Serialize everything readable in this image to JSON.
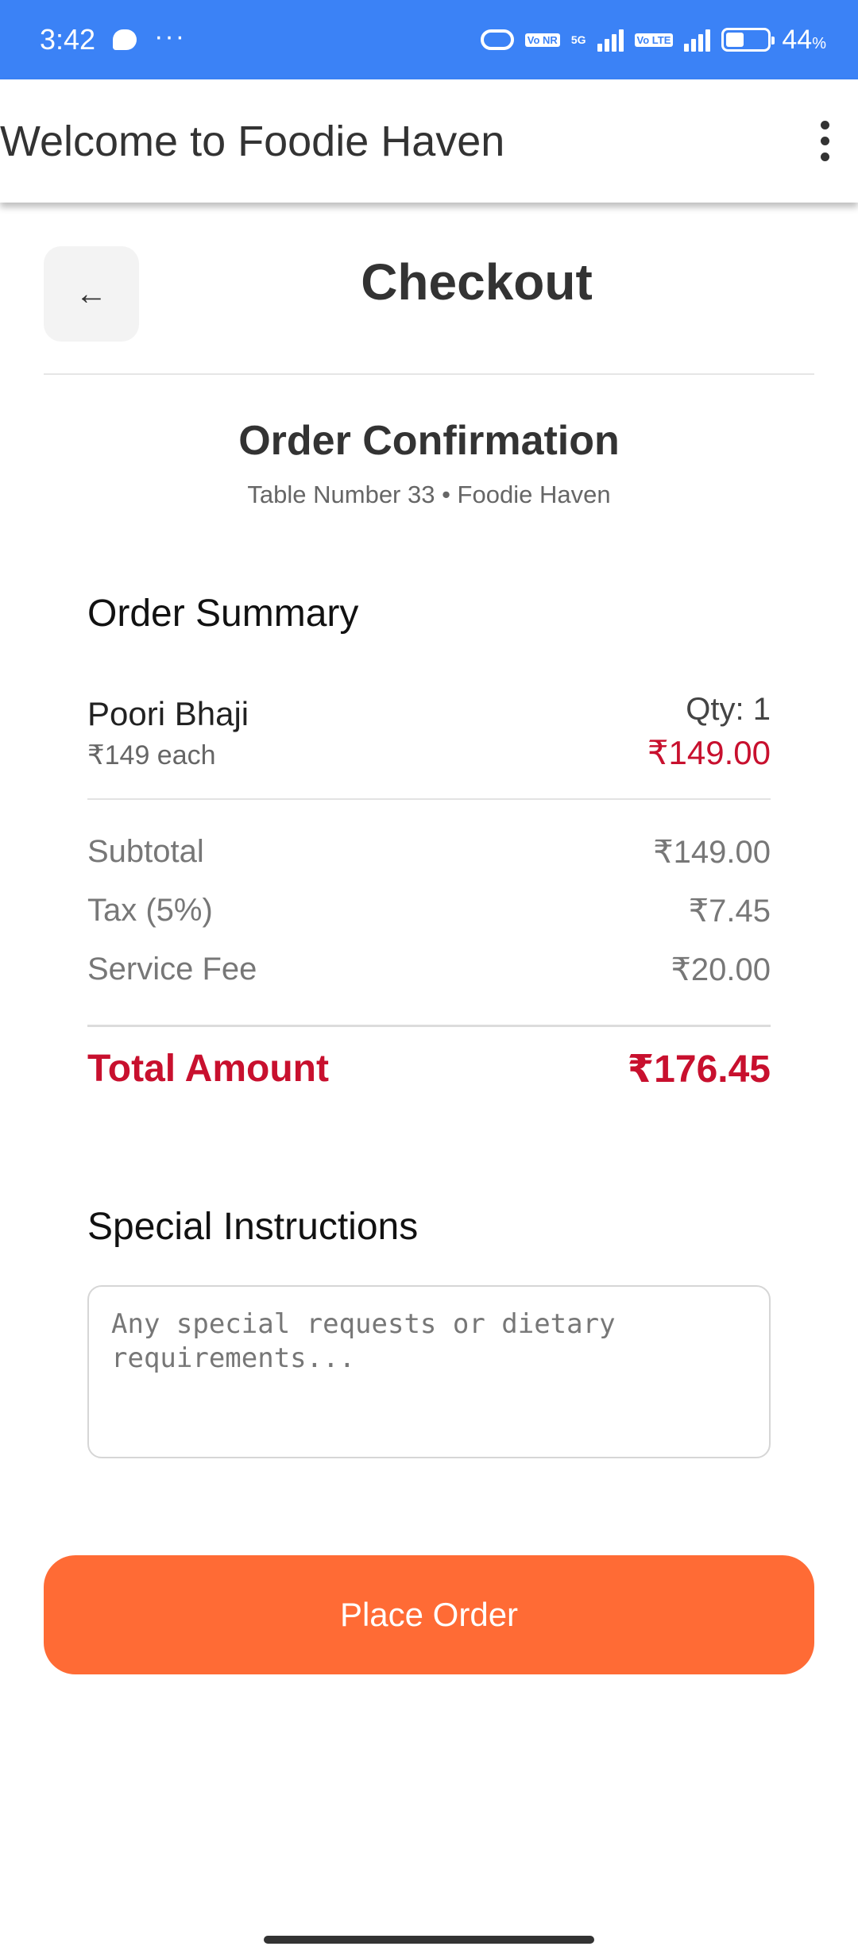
{
  "status_bar": {
    "time": "3:42",
    "network_sim1": "5G",
    "sim1_badge": "Vo NR",
    "sim2_badge": "Vo LTE",
    "battery_percent": "44",
    "battery_unit": "%",
    "battery_level": 0.44,
    "icons": [
      "chat-icon",
      "more-dots-icon",
      "link-icon",
      "signal-icon",
      "battery-icon"
    ]
  },
  "app_bar": {
    "title": "Welcome to Foodie Haven",
    "menu_icon": "kebab-menu-icon"
  },
  "checkout": {
    "back_label": "←",
    "title": "Checkout"
  },
  "confirmation": {
    "title": "Order Confirmation",
    "subtitle": "Table Number 33 • Foodie Haven"
  },
  "summary": {
    "title": "Order Summary",
    "items": [
      {
        "name": "Poori Bhaji",
        "unit_price": "₹149 each",
        "qty": "Qty: 1",
        "line_total": "₹149.00"
      }
    ],
    "fees": [
      {
        "label": "Subtotal",
        "value": "₹149.00"
      },
      {
        "label": "Tax (5%)",
        "value": "₹7.45"
      },
      {
        "label": "Service Fee",
        "value": "₹20.00"
      }
    ],
    "total_label": "Total Amount",
    "total_value": "₹176.45"
  },
  "instructions": {
    "title": "Special Instructions",
    "placeholder": "Any special requests or dietary requirements...",
    "value": ""
  },
  "actions": {
    "place_order_label": "Place Order"
  },
  "colors": {
    "status_bar": "#3b82f6",
    "accent_price": "#c8102e",
    "button": "#ff6b35"
  }
}
